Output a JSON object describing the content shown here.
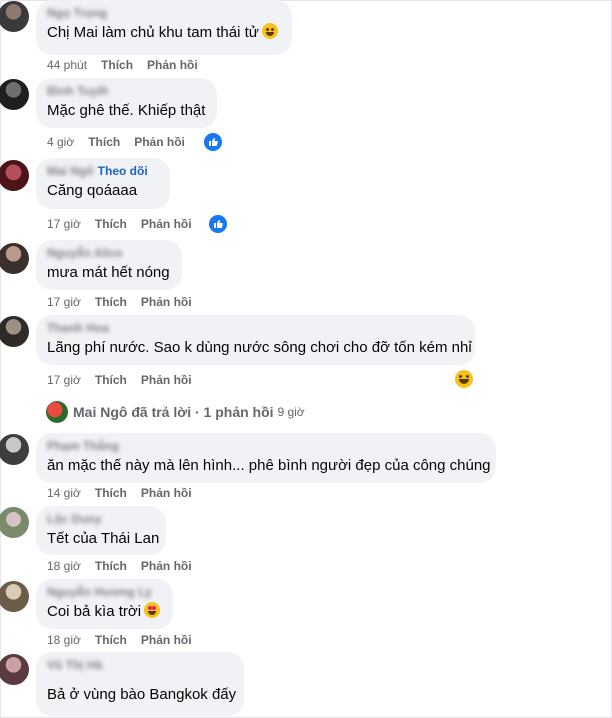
{
  "comments": [
    {
      "author": "Ngọ Trọng",
      "text": "Chị Mai làm chủ khu tam thái tử",
      "emoji": "laugh-emoji",
      "time": "44 phút",
      "like": "Thích",
      "reply": "Phản hồi"
    },
    {
      "author": "Bình Tuyết",
      "text": "Mặc ghê thế. Khiếp thật",
      "time": "4 giờ",
      "like": "Thích",
      "reply": "Phản hồi",
      "reaction": "like-icon"
    },
    {
      "author": "Mai Ngô",
      "follow": "Theo dõi",
      "text": "Căng qoáaaa",
      "time": "17 giờ",
      "like": "Thích",
      "reply": "Phản hồi",
      "reaction": "like-icon"
    },
    {
      "author": "Nguyễn Alice",
      "text": "mưa mát hết nóng",
      "time": "17 giờ",
      "like": "Thích",
      "reply": "Phản hồi"
    },
    {
      "author": "Thanh Hoa",
      "text": "Lãng phí nước. Sao k dùng nước sông chơi cho đỡ tốn kém nhỉ",
      "time": "17 giờ",
      "like": "Thích",
      "reply": "Phản hồi",
      "reaction": "laugh-emoji"
    },
    {
      "author": "Phạm Thắng",
      "text": "ăn mặc thế này mà lên hình... phê bình người đẹp của công chúng",
      "time": "14 giờ",
      "like": "Thích",
      "reply": "Phản hồi"
    },
    {
      "author": "Lộc Duny",
      "text": "Tết của Thái Lan",
      "time": "18 giờ",
      "like": "Thích",
      "reply": "Phản hồi"
    },
    {
      "author": "Nguyễn Hương Ly",
      "text": "Coi bả kìa trời",
      "emoji": "heart-eyes-emoji",
      "time": "18 giờ",
      "like": "Thích",
      "reply": "Phản hồi"
    },
    {
      "author": "Vũ Thị Hà",
      "text": "Bả ở vùng bào Bangkok đấy"
    }
  ],
  "reply_summary": {
    "author": "Mai Ngô",
    "action": "đã trả lời",
    "separator": "·",
    "count": "1 phản hồi",
    "time": "9 giờ"
  },
  "colors": {
    "bubble": "#f0f2f5",
    "meta": "#65676b",
    "like": "#1877f2",
    "follow": "#1d62c4"
  }
}
